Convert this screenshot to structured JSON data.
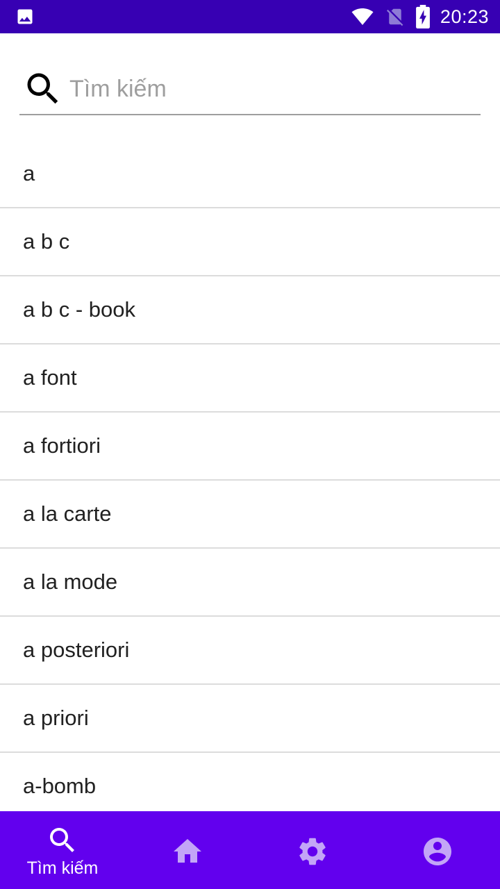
{
  "status_bar": {
    "time": "20:23",
    "icons": [
      "image-icon",
      "wifi-icon",
      "no-sim-icon",
      "battery-charging-icon"
    ],
    "color": "#3700b3"
  },
  "search": {
    "placeholder": "Tìm kiếm",
    "value": "",
    "icon": "search-icon"
  },
  "words": [
    "a",
    "a b c",
    "a b c - book",
    "a font",
    "a fortiori",
    "a la carte",
    "a la mode",
    "a posteriori",
    "a priori",
    "a-bomb"
  ],
  "bottom_nav": {
    "color": "#6200ee",
    "inactive_icon_color": "#c3a5f7",
    "items": [
      {
        "icon": "search-icon",
        "label": "Tìm kiếm",
        "active": true
      },
      {
        "icon": "home-icon",
        "active": false
      },
      {
        "icon": "gear-icon",
        "active": false
      },
      {
        "icon": "account-circle-icon",
        "active": false
      }
    ]
  }
}
